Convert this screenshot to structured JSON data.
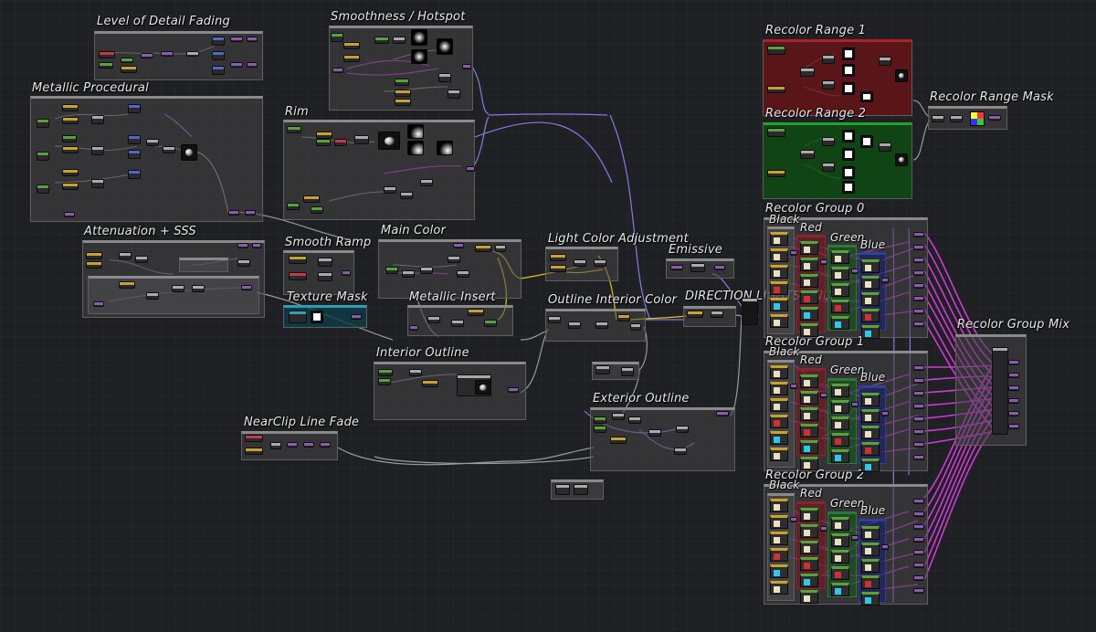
{
  "groups": {
    "lod_fading": "Level of Detail Fading",
    "metallic_procedural": "Metallic Procedural",
    "smoothness_hotspot": "Smoothness / Hotspot",
    "rim": "Rim",
    "attenuation_sss": "Attenuation + SSS",
    "smooth_ramp": "Smooth Ramp",
    "main_color": "Main Color",
    "texture_mask": "Texture Mask",
    "metallic_insert": "Metallic Insert",
    "light_color_adjustment": "Light Color Adjustment",
    "emissive": "Emissive",
    "outline_interior_color": "Outline Interior Color",
    "direction_lights_only": "DIRECTION LIGHTS ONLY",
    "interior_outline": "Interior Outline",
    "nearclip_line_fade": "NearClip Line Fade",
    "exterior_outline": "Exterior Outline",
    "recolor_range_1": "Recolor Range 1",
    "recolor_range_2": "Recolor Range 2",
    "recolor_range_mask": "Recolor Range Mask",
    "recolor_group_0": "Recolor Group 0",
    "recolor_group_1": "Recolor Group 1",
    "recolor_group_2": "Recolor Group 2",
    "recolor_group_mix": "Recolor Group Mix"
  },
  "channels": {
    "black": "Black",
    "red": "Red",
    "green": "Green",
    "blue": "Blue"
  },
  "colors": {
    "background": "#1f2023",
    "wire_default": "#9a9a9a",
    "wire_color": "#d03ad8",
    "wire_vector": "#8a7ae0",
    "wire_scalar": "#e0c020",
    "header_float": "#55a33a",
    "header_vector": "#c8a22a",
    "header_texture": "#8a5ab0"
  }
}
